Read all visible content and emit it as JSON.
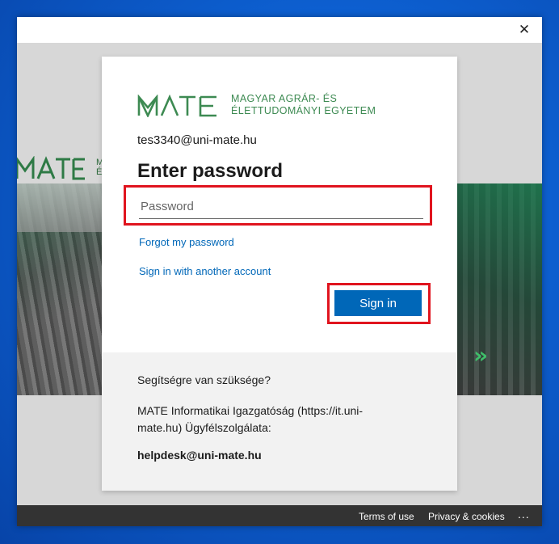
{
  "window": {
    "close_glyph": "✕"
  },
  "background": {
    "logo_text": "M\nÉ"
  },
  "brand": {
    "logo_alt": "MATE",
    "caption_line1": "MAGYAR AGRÁR- ÉS",
    "caption_line2": "ÉLETTUDOMÁNYI EGYETEM",
    "color": "#3d8a52"
  },
  "signin": {
    "identity": "tes3340@uni-mate.hu",
    "heading": "Enter password",
    "password_placeholder": "Password",
    "password_value": "",
    "forgot_link": "Forgot my password",
    "another_account_link": "Sign in with another account",
    "signin_button": "Sign in"
  },
  "help": {
    "title": "Segítségre van szüksége?",
    "text": "MATE Informatikai Igazgatóság (https://it.uni-mate.hu) Ügyfélszolgálata:",
    "email": "helpdesk@uni-mate.hu"
  },
  "footer": {
    "terms": "Terms of use",
    "privacy": "Privacy & cookies",
    "more": "..."
  },
  "colors": {
    "accent": "#0067b8",
    "highlight": "#e0141e",
    "desktop": "#0a56c8"
  }
}
